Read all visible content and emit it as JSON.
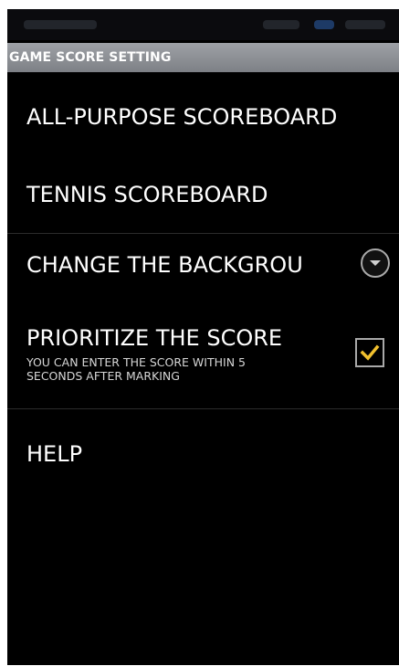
{
  "header": {
    "title": "GAME SCORE SETTING"
  },
  "menu": {
    "all_purpose": "ALL-PURPOSE SCOREBOARD",
    "tennis": "TENNIS SCOREBOARD",
    "change_background": "CHANGE THE BACKGROU",
    "prioritize": {
      "title": "PRIORITIZE THE SCORE",
      "description_line1": "YOU CAN ENTER THE SCORE WITHIN 5",
      "description_line2": "SECONDS AFTER MARKING",
      "checked": true
    },
    "help": "HELP"
  },
  "icons": {
    "dropdown": "chevron-down-icon",
    "checkbox": "check-icon"
  },
  "colors": {
    "background": "#000000",
    "header_bg": "#8a8d92",
    "checkbox_check": "#f2c12e"
  }
}
